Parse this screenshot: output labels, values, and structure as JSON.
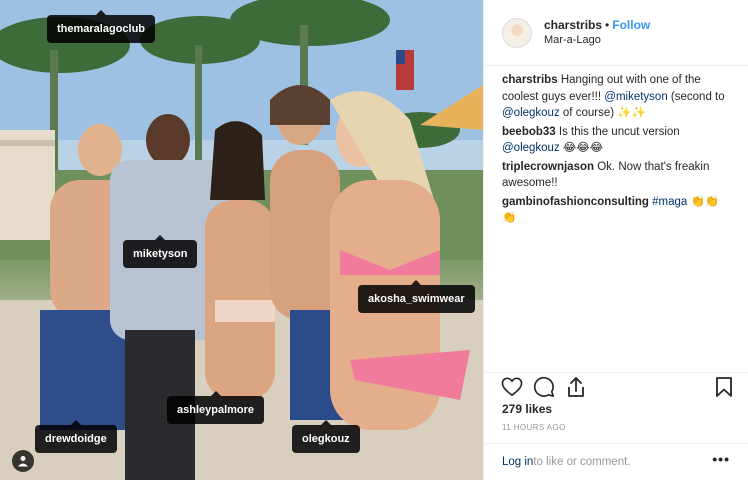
{
  "photo": {
    "tags": [
      "themaralagoclub",
      "miketyson",
      "akosha_swimwear",
      "ashleypalmore",
      "drewdoidge",
      "olegkouz"
    ],
    "user_tag_icon": "person-icon"
  },
  "header": {
    "username": "charstribs",
    "separator": "•",
    "follow_label": "Follow",
    "location": "Mar-a-Lago"
  },
  "comments": [
    {
      "user": "charstribs",
      "pre": "Hanging out with one of the coolest guys ever!!! ",
      "mention1": "@miketyson",
      "mid": " (second to ",
      "mention2": "@olegkouz",
      "post": " of course) ✨✨"
    },
    {
      "user": "beebob33",
      "text": "Is this the uncut version ",
      "mention": "@olegkouz",
      "post": " 😂😂😂"
    },
    {
      "user": "triplecrownjason",
      "text": "Ok. Now that's freakin awesome!!"
    },
    {
      "user": "gambinofashionconsulting",
      "hashtag": "#maga",
      "post": " 👏👏👏"
    }
  ],
  "actions": {
    "like_icon": "heart-icon",
    "comment_icon": "comment-icon",
    "share_icon": "share-icon",
    "save_icon": "bookmark-icon"
  },
  "likes": "279 likes",
  "time_ago": "11 HOURS AGO",
  "login": {
    "link": "Log in",
    "rest": " to like or comment."
  },
  "more_label": "•••"
}
